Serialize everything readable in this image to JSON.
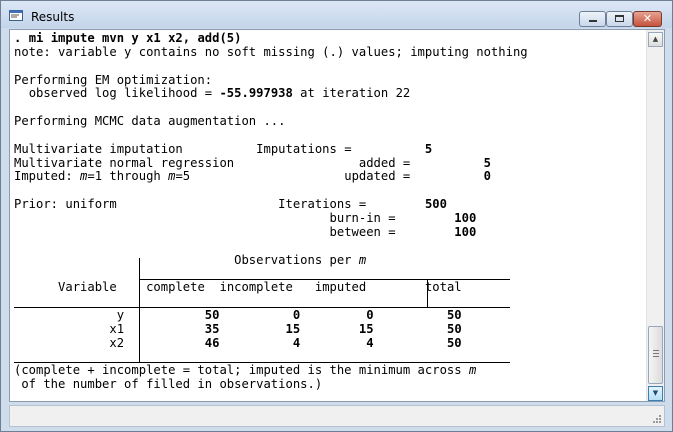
{
  "window": {
    "title": "Results",
    "controls": {
      "minimize_icon": "minimize-icon",
      "maximize_icon": "maximize-icon",
      "close_icon": "close-icon",
      "close_glyph": "✕"
    }
  },
  "console": {
    "command_prefix": ". ",
    "command": "mi impute mvn y x1 x2, add(5)",
    "note": "note: variable y contains no soft missing (.) values; imputing nothing",
    "em_heading": "Performing EM optimization:",
    "em_loglik_label": "observed log likelihood = ",
    "em_loglik_value": "-55.997938",
    "em_iter_text": " at iteration 22",
    "mcmc_heading": "Performing MCMC data augmentation ...",
    "summary_left": {
      "line1": "Multivariate imputation",
      "line2": "Multivariate normal regression",
      "imputed_prefix": "Imputed: ",
      "imputed_m1": "m",
      "imputed_mid": "=1 through ",
      "imputed_m2": "m",
      "imputed_end": "=5",
      "prior": "Prior: uniform"
    },
    "summary_right": {
      "imputations_label": "Imputations =",
      "imputations_value": "5",
      "added_label": "added =",
      "added_value": "5",
      "updated_label": "updated =",
      "updated_value": "0",
      "iterations_label": "Iterations =",
      "iterations_value": "500",
      "burnin_label": "burn-in =",
      "burnin_value": "100",
      "between_label": "between =",
      "between_value": "100"
    },
    "table": {
      "header_title": "Observations per ",
      "header_title_m": "m",
      "variable_header": "Variable",
      "columns": [
        "complete",
        "incomplete",
        "imputed",
        "total"
      ],
      "rows": [
        {
          "variable": "y",
          "complete": "50",
          "incomplete": "0",
          "imputed": "0",
          "total": "50"
        },
        {
          "variable": "x1",
          "complete": "35",
          "incomplete": "15",
          "imputed": "15",
          "total": "50"
        },
        {
          "variable": "x2",
          "complete": "46",
          "incomplete": "4",
          "imputed": "4",
          "total": "50"
        }
      ]
    },
    "footnote_line1": "(complete + incomplete = total; imputed is the minimum across ",
    "footnote_m": "m",
    "footnote_line2": " of the number of filled in observations.)"
  }
}
